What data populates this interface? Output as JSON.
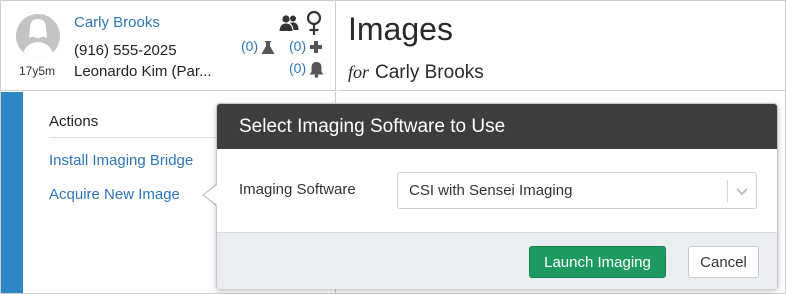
{
  "patient": {
    "name": "Carly Brooks",
    "age": "17y5m",
    "phone": "(916) 555-2025",
    "guardian": "Leonardo Kim (Par...",
    "lab_count": "(0)",
    "problems_count": "(0)",
    "alerts_count": "(0)",
    "icons": [
      "avatar-silhouette",
      "people-icon",
      "female-icon",
      "flask-icon",
      "plus-icon",
      "bell-icon"
    ]
  },
  "page": {
    "title": "Images",
    "subtitle_prefix": "for",
    "subtitle_name": "Carly Brooks"
  },
  "actions": {
    "heading": "Actions",
    "items": [
      {
        "label": "Install Imaging Bridge"
      },
      {
        "label": "Acquire New Image"
      }
    ]
  },
  "modal": {
    "title": "Select Imaging Software to Use",
    "field_label": "Imaging Software",
    "selected_software": "CSI with Sensei Imaging",
    "launch_label": "Launch Imaging",
    "cancel_label": "Cancel"
  },
  "colors": {
    "link": "#2e76b6",
    "rail": "#2e87c4",
    "modal_header": "#3d3d3d",
    "primary_button": "#1e9a60",
    "footer_bg": "#e8eef2"
  }
}
